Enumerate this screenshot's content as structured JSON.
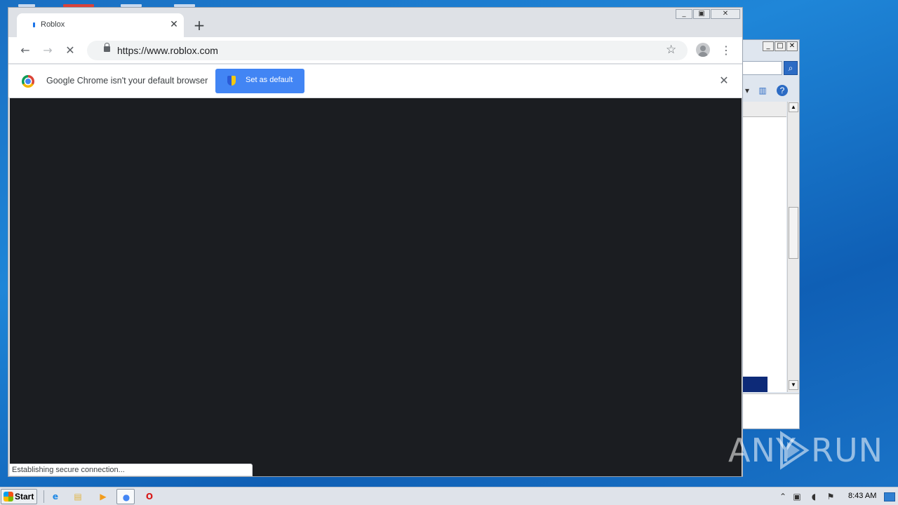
{
  "browser": {
    "tab": {
      "title": "Roblox",
      "close_glyph": "✕"
    },
    "new_tab_glyph": "+",
    "window_controls": [
      "minimize",
      "restore",
      "close"
    ],
    "address": {
      "url": "https://www.roblox.com",
      "secure": true
    },
    "nav": {
      "back_glyph": "←",
      "forward_glyph": "→",
      "stop_glyph": "✕",
      "star_glyph": "☆",
      "menu_glyph": "⋮"
    },
    "infobar": {
      "message": "Google Chrome isn't your default browser",
      "button_label": "Set as default",
      "close_glyph": "✕"
    },
    "status_text": "Establishing secure connection...",
    "content_bg": "#1b1d21"
  },
  "background_window": {
    "controls": [
      "minimize",
      "maximize",
      "close"
    ]
  },
  "watermark": {
    "left": "ANY",
    "right": "RUN"
  },
  "taskbar": {
    "start_label": "Start",
    "apps": [
      {
        "name": "internet-explorer-icon",
        "glyph": "e",
        "color": "#1e88e5"
      },
      {
        "name": "file-explorer-icon",
        "glyph": "▤",
        "color": "#e0b443"
      },
      {
        "name": "media-player-icon",
        "glyph": "▶",
        "color": "#f29b1b"
      },
      {
        "name": "chrome-icon",
        "glyph": "●",
        "color": "#4285f4"
      },
      {
        "name": "opera-icon",
        "glyph": "O",
        "color": "#d71a1a"
      }
    ],
    "clock": "8:43 AM"
  },
  "colors": {
    "accent": "#4285f4",
    "desktop": "#1f86d8",
    "chrome_frame": "#dee1e6"
  }
}
